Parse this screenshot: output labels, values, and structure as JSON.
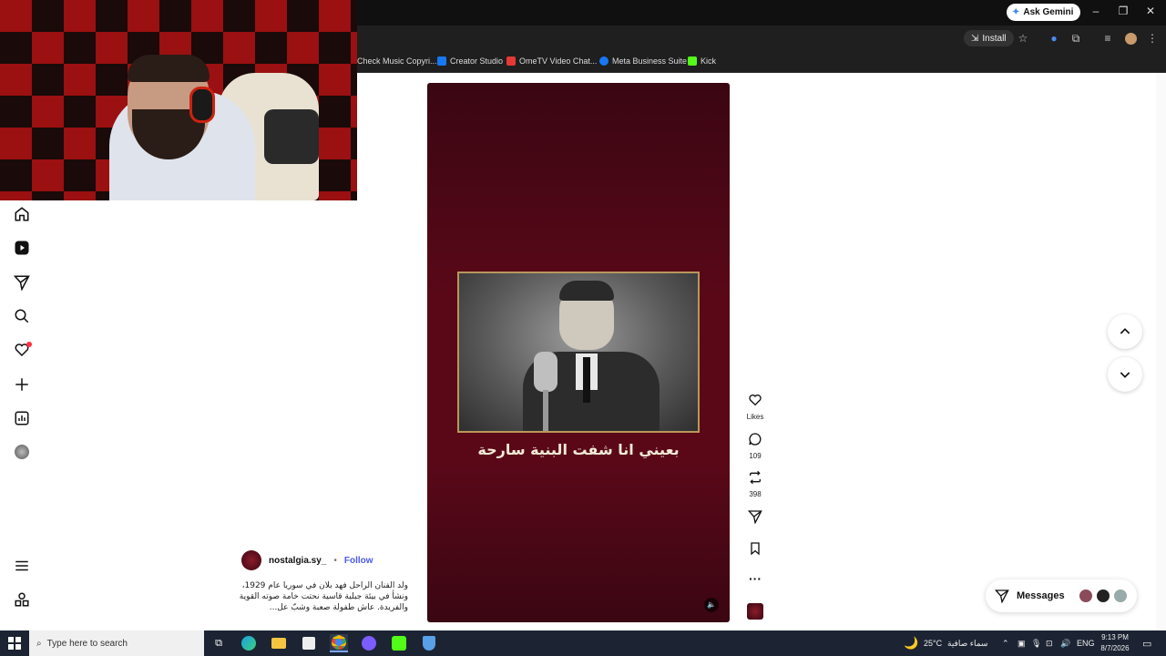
{
  "browser": {
    "ask_gemini": "Ask Gemini",
    "install": "Install",
    "bookmarks": [
      {
        "label": "Check Music Copyri...",
        "color": "#555555"
      },
      {
        "label": "Creator Studio",
        "color": "#1877f2"
      },
      {
        "label": "OmeTV Video Chat...",
        "color": "#e53935"
      },
      {
        "label": "Meta Business Suite",
        "color": "#1877f2"
      },
      {
        "label": "Kick",
        "color": "#53fc18"
      }
    ]
  },
  "reel": {
    "caption_ar": "بعيني انا شفت البنية سارحة",
    "author": "nostalgia.sy_",
    "follow": "Follow",
    "description": "ولد الفنان الراحل فهد بلان في سوريا عام 1929، ونشأ في بيئة جبلية قاسية نحتت خامة صوته القوية والفريدة. عاش طفولة صعبة وشبّ عل...",
    "likes_label": "Likes",
    "comments_count": "109",
    "reposts_count": "398"
  },
  "messages": {
    "label": "Messages"
  },
  "taskbar": {
    "search_placeholder": "Type here to search",
    "weather_temp": "25°C",
    "weather_desc": "سماء صافية",
    "lang": "ENG",
    "time": "9:13 PM",
    "date": "8/7/2026"
  },
  "colors": {
    "reel_bg": "#5a0818",
    "accent_blue": "#4a5be8",
    "notification": "#ff3040"
  }
}
